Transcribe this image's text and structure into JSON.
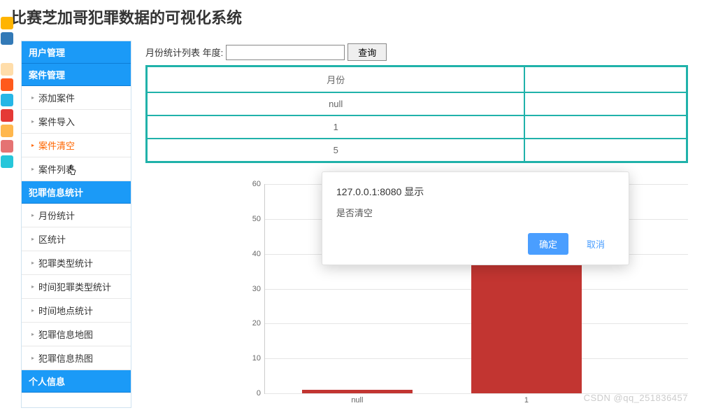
{
  "page_title": "比赛芝加哥犯罪数据的可视化系统",
  "vbar_colors": [
    "#ffb400",
    "#337ab7",
    "#fff",
    "#ffddaa",
    "#ff5a1c",
    "#27b6e6",
    "#e53935",
    "#ffb74d",
    "#e57373",
    "#26c6da"
  ],
  "sidebar": {
    "sections": [
      {
        "title": "用户管理",
        "items": []
      },
      {
        "title": "案件管理",
        "items": [
          {
            "label": "添加案件",
            "active": false
          },
          {
            "label": "案件导入",
            "active": false
          },
          {
            "label": "案件清空",
            "active": true
          },
          {
            "label": "案件列表",
            "active": false
          }
        ]
      },
      {
        "title": "犯罪信息统计",
        "items": [
          {
            "label": "月份统计",
            "active": false
          },
          {
            "label": "区统计",
            "active": false
          },
          {
            "label": "犯罪类型统计",
            "active": false
          },
          {
            "label": "时间犯罪类型统计",
            "active": false
          },
          {
            "label": "时间地点统计",
            "active": false
          },
          {
            "label": "犯罪信息地图",
            "active": false
          },
          {
            "label": "犯罪信息热图",
            "active": false
          }
        ]
      },
      {
        "title": "个人信息",
        "items": []
      }
    ]
  },
  "query": {
    "label": "月份统计列表  年度:",
    "value": "",
    "button": "查询"
  },
  "table": {
    "headers": [
      "月份",
      ""
    ],
    "rows": [
      [
        "null",
        ""
      ],
      [
        "1",
        ""
      ],
      [
        "5",
        ""
      ]
    ]
  },
  "chart_data": {
    "type": "bar",
    "categories": [
      "null",
      "1"
    ],
    "values": [
      1,
      41
    ],
    "ylim": [
      0,
      60
    ],
    "yticks": [
      0,
      10,
      20,
      30,
      40,
      50,
      60
    ]
  },
  "dialog": {
    "title": "127.0.0.1:8080 显示",
    "body": "是否清空",
    "confirm": "确定",
    "cancel": "取消"
  },
  "watermark": "CSDN @qq_251836457"
}
